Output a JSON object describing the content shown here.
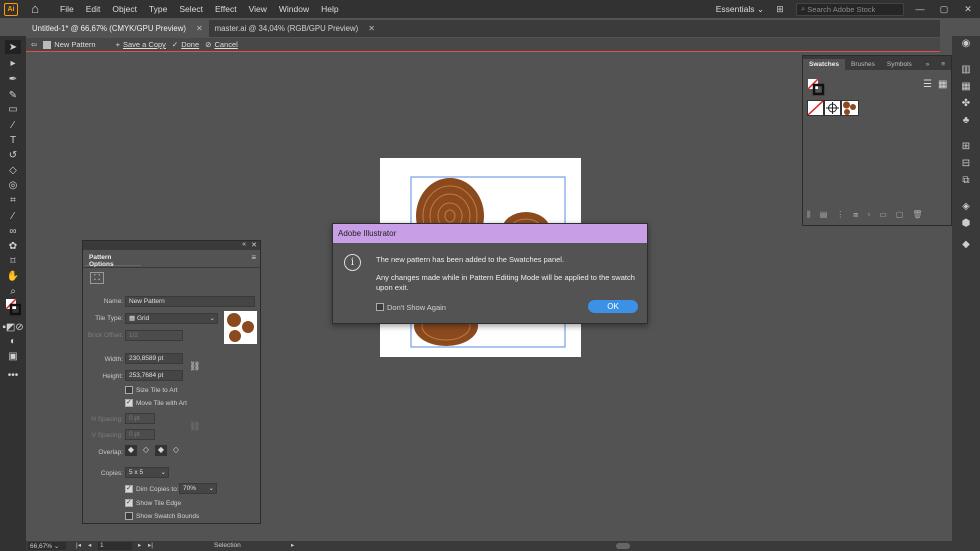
{
  "menubar": {
    "logo": "Ai",
    "menus": [
      "File",
      "Edit",
      "Object",
      "Type",
      "Select",
      "Effect",
      "View",
      "Window",
      "Help"
    ],
    "workspace": "Essentials",
    "search_placeholder": "Search Adobe Stock",
    "icons": [
      "home-icon",
      "grid-icon",
      "search-icon",
      "minimize-icon",
      "maximize-icon",
      "close-icon"
    ]
  },
  "tabs": [
    {
      "label": "Untitled-1* @ 66,67% (CMYK/GPU Preview)",
      "active": true
    },
    {
      "label": "master.ai @ 34,04% (RGB/GPU Preview)",
      "active": false
    }
  ],
  "isolation": {
    "label": "New Pattern",
    "save_copy": "Save a Copy",
    "done": "Done",
    "cancel": "Cancel"
  },
  "swatches_panel": {
    "tabs": [
      "Swatches",
      "Brushes",
      "Symbols"
    ],
    "active_tab": "Swatches"
  },
  "pattern_options": {
    "title": "Pattern Options",
    "name_label": "Name:",
    "name_value": "New Pattern",
    "tile_type_label": "Tile Type:",
    "tile_type_value": "Grid",
    "brick_offset_label": "Brick Offset:",
    "brick_offset_value": "1/2",
    "width_label": "Width:",
    "width_value": "230,8589 pt",
    "height_label": "Height:",
    "height_value": "253,7684 pt",
    "size_tile_to_art": "Size Tile to Art",
    "size_tile_checked": false,
    "move_tile_with_art": "Move Tile with Art",
    "move_tile_checked": true,
    "h_spacing_label": "H Spacing:",
    "h_spacing_value": "0 pt",
    "v_spacing_label": "V Spacing:",
    "v_spacing_value": "0 pt",
    "overlap_label": "Overlap:",
    "copies_label": "Copies:",
    "copies_value": "5 x 5",
    "dim_copies": "Dim Copies to:",
    "dim_copies_value": "70%",
    "dim_checked": true,
    "show_tile_edge": "Show Tile Edge",
    "show_tile_edge_checked": true,
    "show_swatch_bounds": "Show Swatch Bounds",
    "show_swatch_bounds_checked": false
  },
  "dialog": {
    "title": "Adobe Illustrator",
    "message1": "The new pattern has been added to the Swatches panel.",
    "message2": "Any changes made while in Pattern Editing Mode will be applied to the swatch upon exit.",
    "dont_show": "Don't Show Again",
    "ok": "OK"
  },
  "status": {
    "zoom": "66,67%",
    "artboard": "1",
    "tool": "Selection"
  },
  "colors": {
    "dialog_title_bg": "#c89ee6",
    "ok_button": "#3c90e6",
    "isolation_line": "#e05050",
    "wood": "#8b4a1e"
  }
}
